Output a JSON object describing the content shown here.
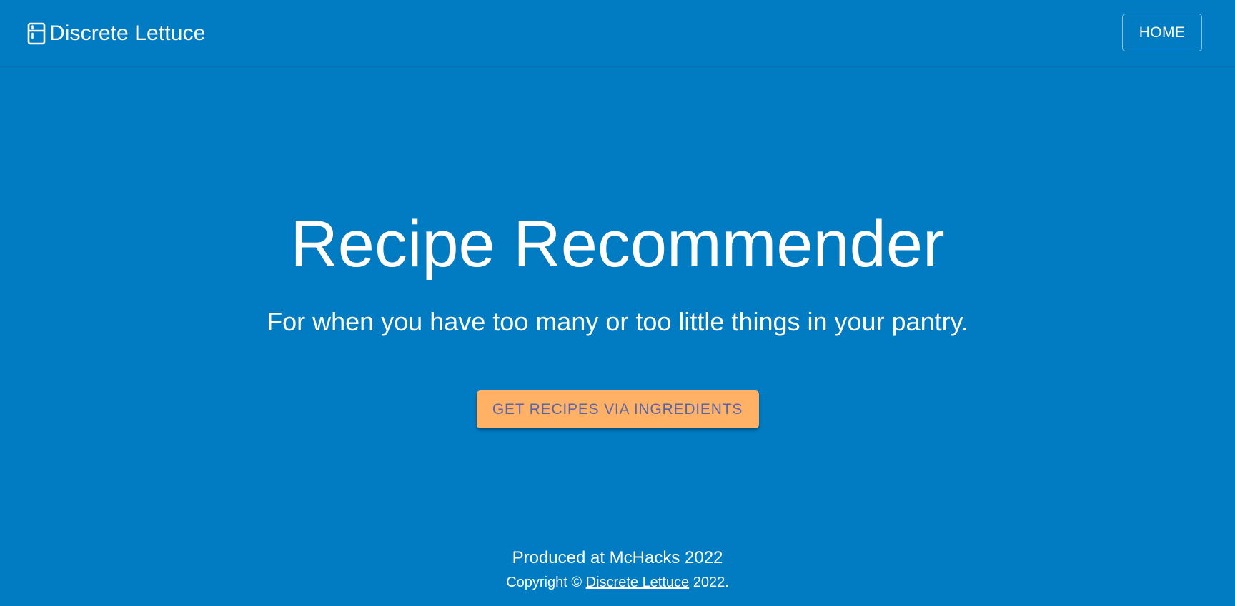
{
  "colors": {
    "background": "#017bc2",
    "text": "#ffffff",
    "cta_background": "#ffb266",
    "cta_text": "#5a65a8"
  },
  "navbar": {
    "brand_icon": "fridge-icon",
    "brand_name": "Discrete Lettuce",
    "home_label": "HOME"
  },
  "hero": {
    "title": "Recipe Recommender",
    "subtitle": "For when you have too many or too little things in your pantry.",
    "cta_label": "GET RECIPES VIA INGREDIENTS"
  },
  "footer": {
    "produced_text": "Produced at McHacks 2022",
    "copyright_prefix": "Copyright © ",
    "copyright_link": "Discrete Lettuce",
    "copyright_suffix": " 2022."
  }
}
